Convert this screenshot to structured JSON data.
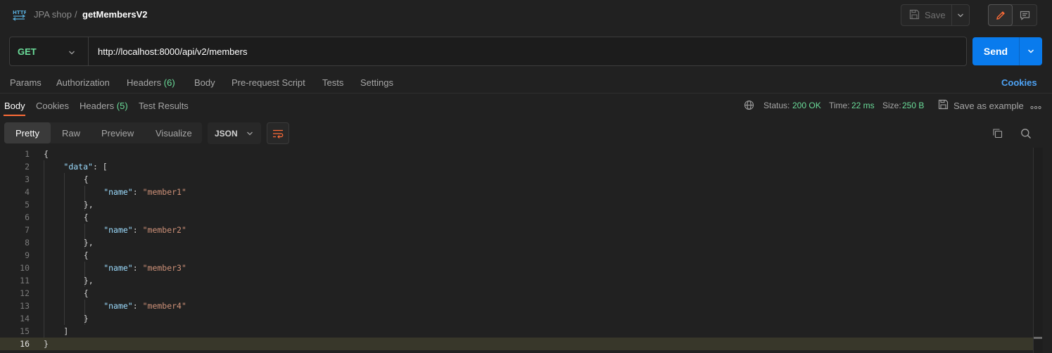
{
  "header": {
    "collection": "JPA shop",
    "separator": "/",
    "request_name": "getMembersV2",
    "save_label": "Save"
  },
  "request": {
    "method": "GET",
    "url": "http://localhost:8000/api/v2/members",
    "send_label": "Send"
  },
  "request_tabs": {
    "params": "Params",
    "authorization": "Authorization",
    "headers": "Headers",
    "headers_count": "(6)",
    "body": "Body",
    "prerequest": "Pre-request Script",
    "tests": "Tests",
    "settings": "Settings",
    "cookies": "Cookies"
  },
  "response_tabs": {
    "body": "Body",
    "cookies": "Cookies",
    "headers": "Headers",
    "headers_count": "(5)",
    "test_results": "Test Results"
  },
  "response_meta": {
    "status_label": "Status:",
    "status_value": "200 OK",
    "time_label": "Time:",
    "time_value": "22 ms",
    "size_label": "Size:",
    "size_value": "250 B",
    "save_example": "Save as example",
    "more": "ooo"
  },
  "viewer": {
    "pretty": "Pretty",
    "raw": "Raw",
    "preview": "Preview",
    "visualize": "Visualize",
    "format": "JSON"
  },
  "response_body": {
    "lines": [
      {
        "n": "1",
        "indent": "",
        "parts": [
          [
            "p",
            "{"
          ]
        ]
      },
      {
        "n": "2",
        "indent": "    ",
        "parts": [
          [
            "k",
            "\"data\""
          ],
          [
            "p",
            ": ["
          ]
        ]
      },
      {
        "n": "3",
        "indent": "        ",
        "parts": [
          [
            "p",
            "{"
          ]
        ]
      },
      {
        "n": "4",
        "indent": "            ",
        "parts": [
          [
            "k",
            "\"name\""
          ],
          [
            "p",
            ": "
          ],
          [
            "s",
            "\"member1\""
          ]
        ]
      },
      {
        "n": "5",
        "indent": "        ",
        "parts": [
          [
            "p",
            "},"
          ]
        ]
      },
      {
        "n": "6",
        "indent": "        ",
        "parts": [
          [
            "p",
            "{"
          ]
        ]
      },
      {
        "n": "7",
        "indent": "            ",
        "parts": [
          [
            "k",
            "\"name\""
          ],
          [
            "p",
            ": "
          ],
          [
            "s",
            "\"member2\""
          ]
        ]
      },
      {
        "n": "8",
        "indent": "        ",
        "parts": [
          [
            "p",
            "},"
          ]
        ]
      },
      {
        "n": "9",
        "indent": "        ",
        "parts": [
          [
            "p",
            "{"
          ]
        ]
      },
      {
        "n": "10",
        "indent": "            ",
        "parts": [
          [
            "k",
            "\"name\""
          ],
          [
            "p",
            ": "
          ],
          [
            "s",
            "\"member3\""
          ]
        ]
      },
      {
        "n": "11",
        "indent": "        ",
        "parts": [
          [
            "p",
            "},"
          ]
        ]
      },
      {
        "n": "12",
        "indent": "        ",
        "parts": [
          [
            "p",
            "{"
          ]
        ]
      },
      {
        "n": "13",
        "indent": "            ",
        "parts": [
          [
            "k",
            "\"name\""
          ],
          [
            "p",
            ": "
          ],
          [
            "s",
            "\"member4\""
          ]
        ]
      },
      {
        "n": "14",
        "indent": "        ",
        "parts": [
          [
            "p",
            "}"
          ]
        ]
      },
      {
        "n": "15",
        "indent": "    ",
        "parts": [
          [
            "p",
            "]"
          ]
        ]
      },
      {
        "n": "16",
        "indent": "",
        "parts": [
          [
            "p",
            "}"
          ]
        ]
      }
    ],
    "highlighted_line": "16"
  },
  "colors": {
    "accent": "#ff6c37",
    "send": "#097bed",
    "green": "#6bdd9a",
    "key": "#9cdcfe",
    "string": "#ce9178"
  }
}
